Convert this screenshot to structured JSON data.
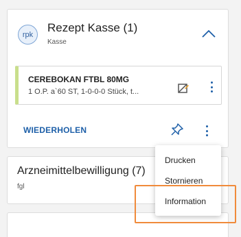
{
  "card1": {
    "avatar": "rpk",
    "title": "Rezept Kasse (1)",
    "subtitle": "Kasse",
    "item": {
      "name": "CEREBOKAN FTBL 80MG",
      "description": "1 O.P. a`60 ST, 1-0-0-0 Stück, t..."
    },
    "footer": {
      "repeat_label": "WIEDERHOLEN"
    }
  },
  "card2": {
    "title": "Arzneimittelbewilligung (7)",
    "subtitle": "fgl"
  },
  "menu": {
    "items": [
      {
        "label": "Drucken"
      },
      {
        "label": "Stornieren"
      },
      {
        "label": "Information"
      }
    ]
  },
  "colors": {
    "accent": "#1d5fa8",
    "item_marker": "#c9df8c",
    "highlight": "#f08a3a"
  },
  "icons": {
    "collapse": "chevron-up-icon",
    "edit": "edit-disabled-icon",
    "pin": "pin-icon",
    "more": "more-vertical-icon"
  }
}
